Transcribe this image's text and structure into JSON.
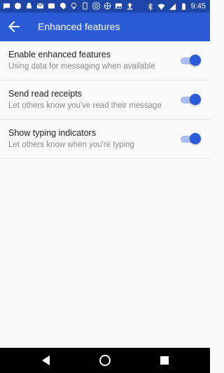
{
  "status_bar": {
    "time": "9:45",
    "left_icons": [
      "chat-icon",
      "messenger-icon",
      "snapchat-icon",
      "gmail-icon",
      "wallet-icon",
      "hangouts-icon",
      "bulb-icon",
      "phone-icon",
      "instagram-icon",
      "basketball-icon",
      "image-icon",
      "upload-icon"
    ],
    "right_icons": [
      "bluetooth-icon",
      "wifi-icon",
      "signal-icon",
      "battery-icon"
    ]
  },
  "app_bar": {
    "title": "Enhanced features",
    "back_icon": "arrow-back-icon"
  },
  "settings": [
    {
      "title": "Enable enhanced features",
      "subtitle": "Using data for messaging when available",
      "enabled": true
    },
    {
      "title": "Send read receipts",
      "subtitle": "Let others know you've read their message",
      "enabled": true
    },
    {
      "title": "Show typing indicators",
      "subtitle": "Let others know when you're typing",
      "enabled": true
    }
  ],
  "colors": {
    "status_bar": "#1e45a8",
    "app_bar": "#2b5bd7",
    "toggle_on": "#2b5bd7",
    "toggle_track_on": "#a9bdf0"
  },
  "nav_bar": {
    "back_icon": "nav-back-icon",
    "home_icon": "nav-home-icon",
    "recents_icon": "nav-recents-icon"
  }
}
